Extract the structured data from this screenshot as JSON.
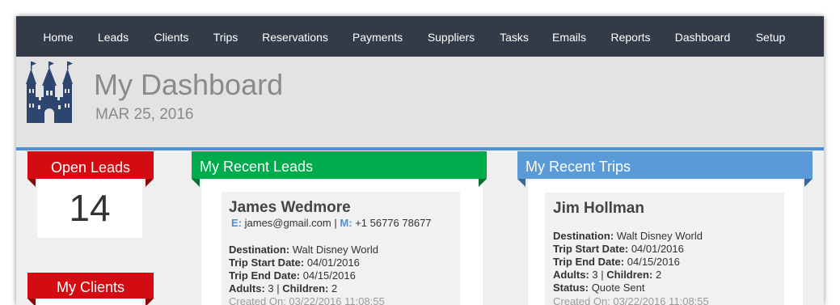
{
  "nav": {
    "items": [
      "Home",
      "Leads",
      "Clients",
      "Trips",
      "Reservations",
      "Payments",
      "Suppliers",
      "Tasks",
      "Emails",
      "Reports",
      "Dashboard",
      "Setup"
    ]
  },
  "header": {
    "title": "My Dashboard",
    "date": "MAR 25, 2016",
    "logo_icon": "castle-icon",
    "logo_color": "#2d4670"
  },
  "colors": {
    "nav_bg": "#343b48",
    "accent_blue": "#4e91d2",
    "red": "#d40c12",
    "green": "#00ab4b"
  },
  "widgets": {
    "open_leads": {
      "label": "Open Leads",
      "count": "14"
    },
    "my_clients": {
      "label": "My Clients"
    }
  },
  "recent_leads": {
    "title": "My Recent Leads",
    "card": {
      "name": "James Wedmore",
      "email_key": "E:",
      "email": "james@gmail.com",
      "separator": "|",
      "mobile_key": "M:",
      "mobile": "+1 56776 78677",
      "destination_label": "Destination:",
      "destination": "Walt Disney World",
      "start_label": "Trip Start Date:",
      "start": "04/01/2016",
      "end_label": "Trip End Date:",
      "end": "04/15/2016",
      "adults_label": "Adults:",
      "adults": "3",
      "children_label": "Children:",
      "children": "2",
      "created": "Created On: 03/22/2016 11:08:55"
    }
  },
  "recent_trips": {
    "title": "My Recent Trips",
    "card": {
      "name": "Jim Hollman",
      "destination_label": "Destination:",
      "destination": "Walt Disney World",
      "start_label": "Trip Start Date:",
      "start": "04/01/2016",
      "end_label": "Trip End Date:",
      "end": "04/15/2016",
      "adults_label": "Adults:",
      "adults": "3",
      "children_label": "Children:",
      "children": "2",
      "status_label": "Status:",
      "status": "Quote Sent",
      "created": "Created On: 03/22/2016 11:08:55"
    }
  }
}
